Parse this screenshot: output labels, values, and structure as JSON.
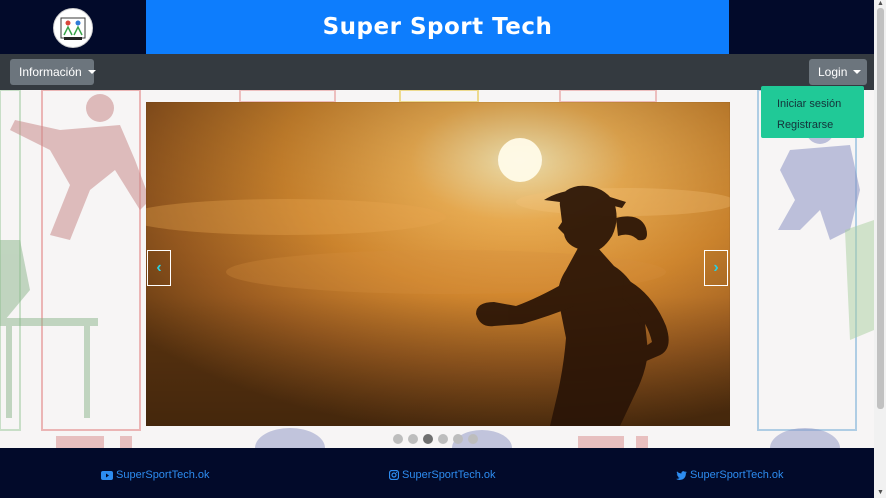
{
  "header": {
    "title": "Super Sport Tech",
    "logo_label": "Logo"
  },
  "navbar": {
    "info_button": "Información",
    "login_button": "Login"
  },
  "dropdown": {
    "items": [
      "Iniciar sesión",
      "Registrarse"
    ]
  },
  "carousel": {
    "prev_glyph": "‹",
    "next_glyph": "›",
    "indicator_count": 6,
    "active_index": 2
  },
  "footer": {
    "youtube": "SuperSportTech.ok",
    "instagram": "SuperSportTech.ok",
    "twitter": "SuperSportTech.ok"
  },
  "colors": {
    "header_bg": "#020a2a",
    "title_bg": "#0d7dfd",
    "navbar_bg": "#343a40",
    "dropdown_bg": "#20c997",
    "footer_link": "#2d8cf0",
    "control_accent": "#2dcfdd"
  },
  "icons": {
    "youtube": "youtube-icon",
    "instagram": "instagram-icon",
    "twitter": "twitter-icon"
  }
}
